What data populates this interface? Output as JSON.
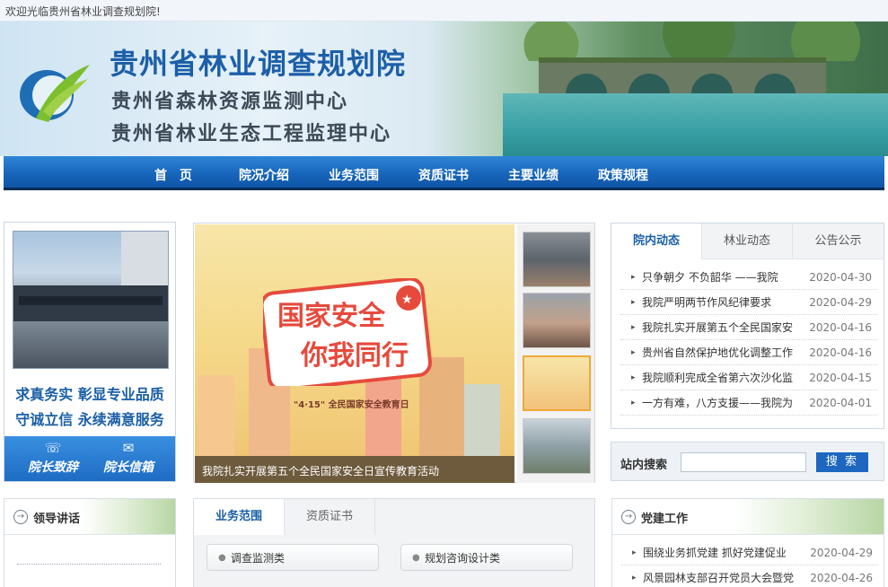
{
  "topbar": {
    "welcome": "欢迎光临贵州省林业调查规划院!"
  },
  "header": {
    "title": "贵州省林业调查规划院",
    "subtitle1": "贵州省森林资源监测中心",
    "subtitle2": "贵州省林业生态工程监理中心"
  },
  "nav": {
    "items": [
      "首　页",
      "院况介绍",
      "业务范围",
      "资质证书",
      "主要业绩",
      "政策规程"
    ]
  },
  "left": {
    "slogan1": "求真务实 彰显专业品质",
    "slogan2": "守诚立信 永续满意服务",
    "btn1": "院长致辞",
    "btn2": "院长信箱"
  },
  "carousel": {
    "caption": "我院扎实开展第五个全民国家安全日宣传教育活动",
    "slide_text_line1": "国家安全",
    "slide_text_line2": "你我同行",
    "slide_day": "\"4·15\" 全民国家安全教育日"
  },
  "news": {
    "tabs": [
      "院内动态",
      "林业动态",
      "公告公示"
    ],
    "items": [
      {
        "title": "只争朝夕 不负韶华 ——我院",
        "date": "2020-04-30"
      },
      {
        "title": "我院严明两节作风纪律要求",
        "date": "2020-04-29"
      },
      {
        "title": "我院扎实开展第五个全民国家安",
        "date": "2020-04-16"
      },
      {
        "title": "贵州省自然保护地优化调整工作",
        "date": "2020-04-16"
      },
      {
        "title": "我院顺利完成全省第六次沙化监",
        "date": "2020-04-15"
      },
      {
        "title": "一方有难，八方支援——我院为",
        "date": "2020-04-01"
      }
    ]
  },
  "search": {
    "label": "站内搜索",
    "button": "搜 索",
    "value": ""
  },
  "leadership": {
    "heading": "领导讲话"
  },
  "business": {
    "tabs": [
      "业务范围",
      "资质证书"
    ],
    "pills": [
      "调查监测类",
      "规划咨询设计类"
    ]
  },
  "party": {
    "heading": "党建工作",
    "items": [
      {
        "title": "围绕业务抓党建 抓好党建促业",
        "date": "2020-04-29"
      },
      {
        "title": "风景园林支部召开党员大会暨党",
        "date": "2020-04-26"
      }
    ]
  },
  "colors": {
    "nav_blue": "#1766bc",
    "title_blue": "#1c5fa8",
    "accent_orange": "#f0a83a"
  }
}
